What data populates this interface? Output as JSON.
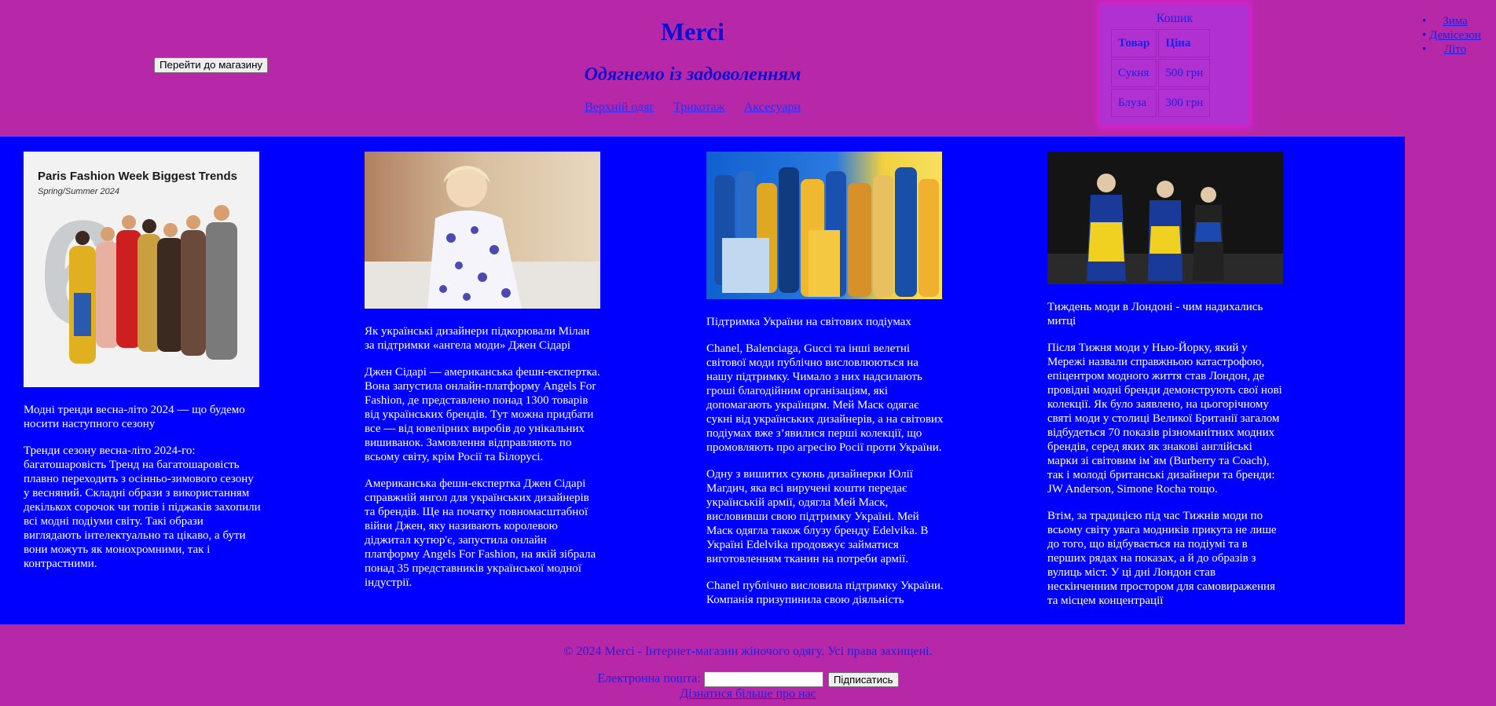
{
  "header": {
    "shop_button": "Перейти до магазину",
    "title": "Merci",
    "tagline": "Одягнемо із задоволенням",
    "nav": [
      "Верхній одяг",
      "Трикотаж",
      "Аксесуари"
    ]
  },
  "cart": {
    "title": "Кошик",
    "columns": [
      "Товар",
      "Ціна"
    ],
    "rows": [
      {
        "item": "Сукня",
        "price": "500 грн"
      },
      {
        "item": "Блуза",
        "price": "300 грн"
      }
    ]
  },
  "seasons": [
    "Зима",
    "Демісезон",
    "Літо"
  ],
  "colors": {
    "page_bg": "#b628a8",
    "content_bg": "#0000ff",
    "link": "#2020e0"
  },
  "articles": [
    {
      "image": {
        "caption_lines": [
          "Paris Fashion Week Biggest Trends",
          "Spring/Summer 2024"
        ],
        "big_number": "6"
      },
      "title": "Модні тренди весна-літо 2024 — що будемо носити наступного сезону",
      "paragraphs": [
        "Тренди сезону весна-літо 2024-го: багатошаровість Тренд на багатошаровість плавно переходить з осінньо-зимового сезону у весняний. Складні образи з використанням декількох сорочок чи топів і піджаків захопили всі модні подіуми світу. Такі образи виглядають інтелектуально та цікаво, а бути вони можуть як монохромними, так і контрастними."
      ]
    },
    {
      "title": "Як українські дизайнери підкорювали Мілан за підтримки «ангела моди» Джен Сідарі",
      "paragraphs": [
        "Джен Сідарі — американська фешн-експертка. Вона запустила онлайн-платформу Angels For Fashion, де представлено понад 1300 товарів від українських брендів. Тут можна придбати все — від ювелірних виробів до унікальних вишиванок. Замовлення відправляють по всьому світу, крім Росії та Білорусі.",
        "Американська фешн-експертка Джен Сідарі справжній янгол для українських дизайнерів та брендів. Ще на початку повномасштабної війни Джен, яку називають королевою діджитал кутюр'є, запустила онлайн платформу Angels For Fashion, на якій зібрала понад 35 представників української модної індустрії."
      ]
    },
    {
      "title": "Підтримка України на світових подіумах",
      "paragraphs": [
        "Chanel, Balenciaga, Gucci та інші велетні світової моди публічно висловлюються на нашу підтримку. Чимало з них надсилають гроші благодійним організаціям, які допомагають українцям. Мей Маск одягає сукні від українських дизайнерів, а на світових подіумах вже з’явилися перші колекції, що промовляють про агресію Росії проти України.",
        "Одну з вишитих суконь дизайнерки Юлії Магдич, яка всі виручені кошти передає українській армії, одягла Мей Маск, висловивши свою підтримку Україні. Мей Маск одягла також блузу бренду Edelvika. В Україні Edelvika продовжує займатися виготовленням тканин на потреби армії.",
        "Chanel публічно висловила підтримку України. Компанія призупинила свою діяльність"
      ]
    },
    {
      "title": "Тиждень моди в Лондоні - чим надихались митці",
      "paragraphs": [
        "Після Тижня моди у Нью-Йорку, який у Мережі назвали справжньою катастрофою, епіцентром модного життя став Лондон, де провідні модні бренди демонструють свої нові колекції. Як було заявлено, на цьогорічному святі моди у столиці Великої Британії загалом відбудеться 70 показів різноманітних модних брендів, серед яких як знакові англійські марки зі світовим ім`ям (Burberry та Coach), так і молоді британські дизайнери та бренди: JW Anderson, Simone Rocha тощо.",
        "Втім, за традицією під час Тижнів моди по всьому світу увага модників прикута не лише до того, що відбувається на подіумі та в перших рядах на показах, а й до образів з вулиць міст. У ці дні Лондон став нескінченним простором для самовираження та місцем концентрації"
      ]
    }
  ],
  "footer": {
    "copyright": "© 2024 Merci - Інтернет-магазин жіночого одягу. Усі права захищені.",
    "email_label": "Електронна пошта:",
    "email_value": "",
    "subscribe_button": "Підписатись",
    "about_link": "Дізнатися більше про нас"
  }
}
